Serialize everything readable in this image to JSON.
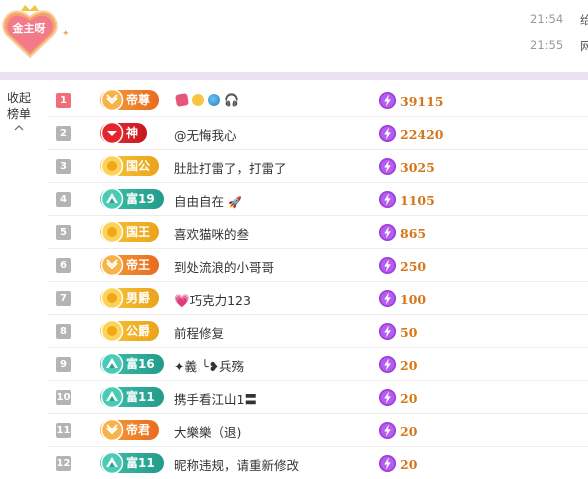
{
  "header": {
    "logo_text": "金主呀",
    "messages": [
      {
        "time": "21:54",
        "text": "给"
      },
      {
        "time": "21:55",
        "text": "网"
      }
    ]
  },
  "collapse": {
    "line1": "收起",
    "line2": "榜单"
  },
  "colors": {
    "rank_top": "#ef6e7a",
    "rank_normal": "#b4b4b4",
    "score": "#d77619",
    "badge_orange": "#ea6a1f",
    "badge_red": "#c8161e",
    "badge_gold": "#eba21a",
    "badge_teal": "#239b8a"
  },
  "ranking": [
    {
      "rank": "1",
      "badge": "帝尊",
      "style": "orange",
      "name": "",
      "extras": [
        "heart-icon",
        "face-icon",
        "globe-icon",
        "headphones-icon"
      ],
      "score": "39115"
    },
    {
      "rank": "2",
      "badge": "神",
      "style": "red",
      "name": "@无悔我心",
      "extras": [],
      "score": "22420"
    },
    {
      "rank": "3",
      "badge": "国公",
      "style": "gold",
      "name": "肚肚打雷了，打雷了",
      "extras": [],
      "score": "3025"
    },
    {
      "rank": "4",
      "badge": "富19",
      "style": "teal",
      "name": "自由自在",
      "extras": [
        "rocket-icon"
      ],
      "score": "1105"
    },
    {
      "rank": "5",
      "badge": "国王",
      "style": "gold",
      "name": "喜欢猫咪的叁",
      "extras": [],
      "score": "865"
    },
    {
      "rank": "6",
      "badge": "帝王",
      "style": "orange",
      "name": "到处流浪的小哥哥",
      "extras": [],
      "score": "250"
    },
    {
      "rank": "7",
      "badge": "男爵",
      "style": "gold",
      "name": "💗巧克力123",
      "extras": [],
      "score": "100"
    },
    {
      "rank": "8",
      "badge": "公爵",
      "style": "gold",
      "name": "前程修复",
      "extras": [],
      "score": "50"
    },
    {
      "rank": "9",
      "badge": "富16",
      "style": "teal",
      "name": "✦義 ╰❥兵殇",
      "extras": [],
      "score": "20"
    },
    {
      "rank": "10",
      "badge": "富11",
      "style": "teal",
      "name": "携手看江山1〓",
      "extras": [],
      "score": "20"
    },
    {
      "rank": "11",
      "badge": "帝君",
      "style": "orange",
      "name": "大樂樂（退)",
      "extras": [],
      "score": "20"
    },
    {
      "rank": "12",
      "badge": "富11",
      "style": "teal",
      "name": "昵称违规，请重新修改",
      "extras": [],
      "score": "20"
    }
  ]
}
